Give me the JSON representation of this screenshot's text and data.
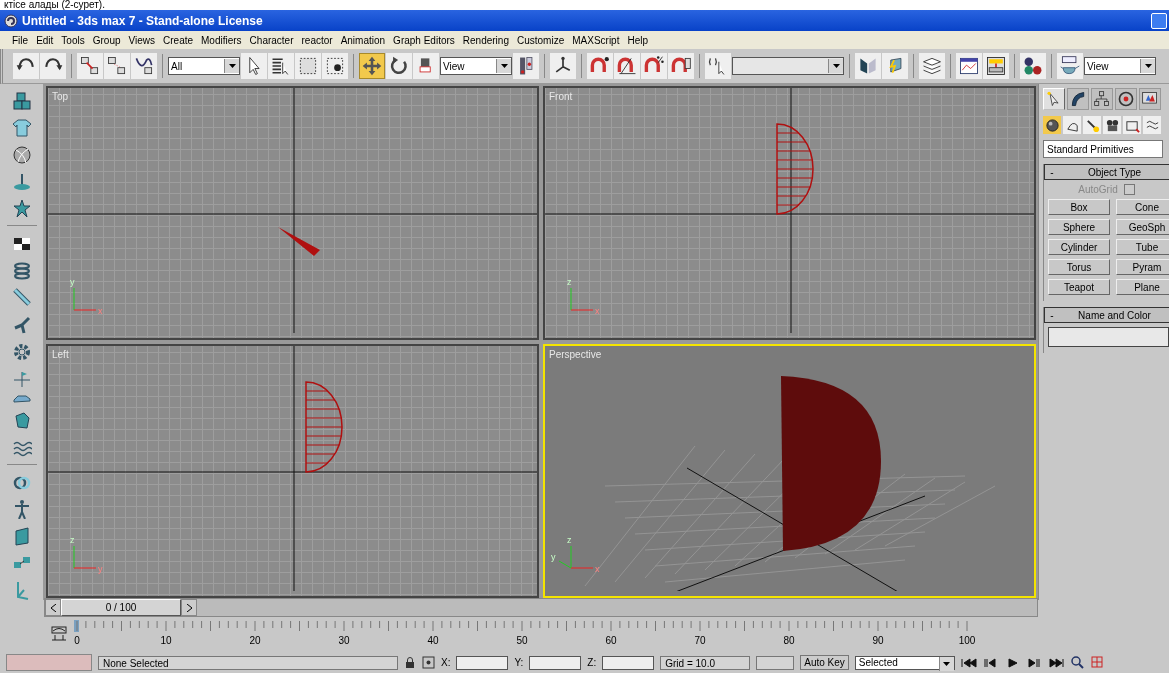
{
  "caption": "ктісе алады (2-сурет).",
  "window": {
    "title": "Untitled - 3ds max 7  - Stand-alone License"
  },
  "menu": [
    "File",
    "Edit",
    "Tools",
    "Group",
    "Views",
    "Create",
    "Modifiers",
    "Character",
    "reactor",
    "Animation",
    "Graph Editors",
    "Rendering",
    "Customize",
    "MAXScript",
    "Help"
  ],
  "toolbar": [
    {
      "kind": "undo",
      "selected": false
    },
    {
      "kind": "redo",
      "selected": false
    },
    {
      "kind": "separator"
    },
    {
      "kind": "link",
      "selected": false
    },
    {
      "kind": "unlink",
      "selected": false
    },
    {
      "kind": "bind",
      "selected": false
    },
    {
      "kind": "separator"
    },
    {
      "kind": "dropdown",
      "value": "All"
    },
    {
      "kind": "select",
      "selected": false
    },
    {
      "kind": "selectbyname",
      "selected": false
    },
    {
      "kind": "region",
      "selected": false
    },
    {
      "kind": "crossing",
      "selected": false
    },
    {
      "kind": "separator"
    },
    {
      "kind": "move",
      "selected": true
    },
    {
      "kind": "rotate",
      "selected": false
    },
    {
      "kind": "scale",
      "selected": false
    },
    {
      "kind": "dropdown",
      "value": "View"
    },
    {
      "kind": "pivot",
      "selected": false
    },
    {
      "kind": "separator"
    },
    {
      "kind": "axis",
      "selected": false
    },
    {
      "kind": "separator"
    },
    {
      "kind": "snap",
      "selected": false
    },
    {
      "kind": "anglesnap",
      "selected": false
    },
    {
      "kind": "percentsnap",
      "selected": false
    },
    {
      "kind": "spinnersnap",
      "selected": false
    },
    {
      "kind": "separator"
    },
    {
      "kind": "namedsel",
      "selected": false
    },
    {
      "kind": "field"
    },
    {
      "kind": "separator"
    },
    {
      "kind": "mirror",
      "selected": false
    },
    {
      "kind": "align",
      "selected": false
    },
    {
      "kind": "separator"
    },
    {
      "kind": "layers",
      "selected": false
    },
    {
      "kind": "separator"
    },
    {
      "kind": "curves",
      "selected": false
    },
    {
      "kind": "schematic",
      "selected": false
    },
    {
      "kind": "separator"
    },
    {
      "kind": "material",
      "selected": false
    },
    {
      "kind": "separator"
    },
    {
      "kind": "render",
      "selected": false
    },
    {
      "kind": "dropdown",
      "value": "View"
    }
  ],
  "viewports": [
    {
      "label": "Top",
      "kind": "wedge",
      "selected": false,
      "axes": [
        "y",
        "x"
      ]
    },
    {
      "label": "Front",
      "kind": "wire",
      "selected": false,
      "axes": [
        "z",
        "x"
      ]
    },
    {
      "label": "Left",
      "kind": "wire",
      "selected": false,
      "axes": [
        "z",
        "y"
      ]
    },
    {
      "label": "Perspective",
      "kind": "solid",
      "selected": true,
      "axes": [
        "z",
        "x",
        "y"
      ]
    }
  ],
  "command_panel": {
    "tabs": [
      {
        "kind": "create",
        "selected": true
      },
      {
        "kind": "modify",
        "selected": false
      },
      {
        "kind": "hierarchy",
        "selected": false
      },
      {
        "kind": "motion",
        "selected": false
      },
      {
        "kind": "display",
        "selected": false
      }
    ],
    "categories": [
      {
        "kind": "geometry",
        "selected": true
      },
      {
        "kind": "shapes",
        "selected": false
      },
      {
        "kind": "lights",
        "selected": false
      },
      {
        "kind": "cameras",
        "selected": false
      },
      {
        "kind": "helpers",
        "selected": false
      },
      {
        "kind": "warps",
        "selected": false
      }
    ],
    "type_dropdown": "Standard Primitives",
    "object_type": {
      "toggle": "-",
      "title": "Object Type",
      "autogrid": {
        "label": "AutoGrid",
        "checked": false
      },
      "buttons": [
        "Box",
        "Cone",
        "Sphere",
        "GeoSph",
        "Cylinder",
        "Tube",
        "Torus",
        "Pyram",
        "Teapot",
        "Plane"
      ]
    },
    "name_and_color": {
      "toggle": "-",
      "title": "Name and Color"
    }
  },
  "timeline": {
    "frame": "0 / 100",
    "labels": [
      "0",
      "10",
      "20",
      "30",
      "40",
      "50",
      "60",
      "70",
      "80",
      "90",
      "100"
    ]
  },
  "status_bar": {
    "selection": "None Selected",
    "x_label": "X:",
    "y_label": "Y:",
    "z_label": "Z:",
    "grid": "Grid = 10.0",
    "auto_key": "Auto Key",
    "key_filter": "Selected"
  }
}
